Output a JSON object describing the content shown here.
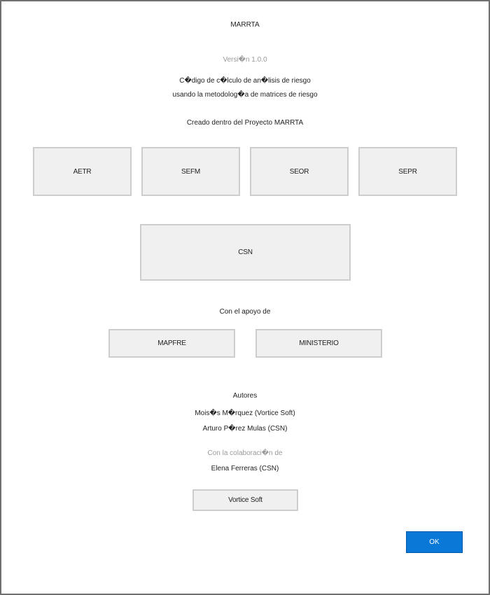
{
  "window": {
    "title": "MARRTA",
    "version": "Versi�n 1.0.0",
    "description_line1": "C�digo de c�lculo de an�lisis de riesgo",
    "description_line2": "usando la metodolog�a de matrices de riesgo",
    "created_within": "Creado dentro del Proyecto MARRTA"
  },
  "partners": [
    {
      "label": "AETR"
    },
    {
      "label": "SEFM"
    },
    {
      "label": "SEOR"
    },
    {
      "label": "SEPR"
    }
  ],
  "csn": {
    "label": "CSN"
  },
  "support": {
    "heading": "Con el apoyo de",
    "items": [
      {
        "label": "MAPFRE"
      },
      {
        "label": "MINISTERIO"
      }
    ]
  },
  "authors": {
    "heading": "Autores",
    "list": [
      "Mois�s M�rquez (Vortice Soft)",
      "Arturo P�rez Mulas (CSN)"
    ]
  },
  "collaboration": {
    "heading": "Con la colaboraci�n de",
    "list": [
      "Elena Ferreras (CSN)"
    ]
  },
  "vortice": {
    "label": "Vortice Soft"
  },
  "buttons": {
    "ok": "OK"
  }
}
